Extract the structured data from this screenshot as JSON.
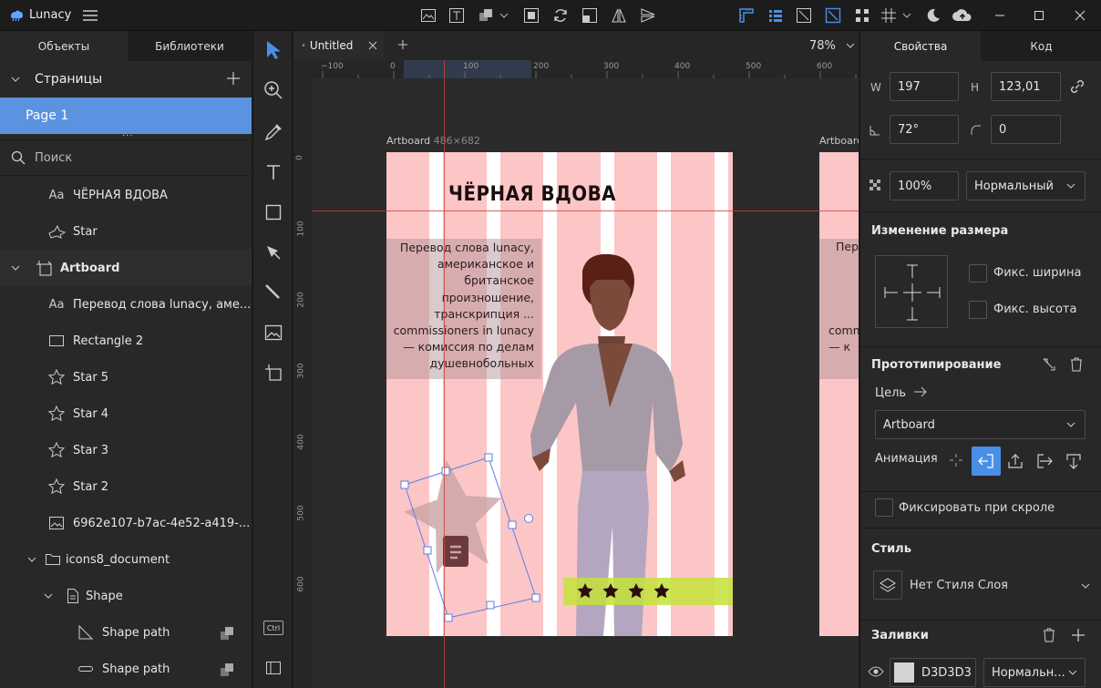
{
  "app": {
    "name": "Lunacy"
  },
  "left": {
    "tabs": [
      "Объекты",
      "Библиотеки"
    ],
    "pages_header": "Страницы",
    "page_selected": "Page 1",
    "search_placeholder": "Поиск",
    "layers": [
      {
        "label": "ЧЁРНАЯ  ВДОВА",
        "icon": "text-icon"
      },
      {
        "label": "Star",
        "icon": "star-outline-icon"
      },
      {
        "label": "Artboard",
        "icon": "artboard-icon"
      },
      {
        "label": "Перевод слова lunacy, аме...",
        "icon": "text-icon"
      },
      {
        "label": "Rectangle 2",
        "icon": "rectangle-icon"
      },
      {
        "label": "Star 5",
        "icon": "star-icon"
      },
      {
        "label": "Star 4",
        "icon": "star-icon"
      },
      {
        "label": "Star 3",
        "icon": "star-icon"
      },
      {
        "label": "Star 2",
        "icon": "star-icon"
      },
      {
        "label": "6962e107-b7ac-4e52-a419-...",
        "icon": "image-icon"
      },
      {
        "label": "icons8_document",
        "icon": "folder-icon"
      },
      {
        "label": "Shape",
        "icon": "shape-icon"
      },
      {
        "label": "Shape path",
        "icon": "triangle-path-icon"
      },
      {
        "label": "Shape path",
        "icon": "line-path-icon"
      }
    ]
  },
  "canvas": {
    "tab_title": "Untitled",
    "zoom": "78%",
    "hruler_labels": [
      "−100",
      "0",
      "100",
      "200",
      "300",
      "400",
      "500",
      "600"
    ],
    "vruler_labels": [
      "0",
      "100",
      "200",
      "300",
      "400",
      "500",
      "600"
    ],
    "artboard_label": "Artboard",
    "artboard_size": "486×682",
    "artboard2_label": "Artboard",
    "heading": "ЧЁРНАЯ  ВДОВА",
    "body_text": "Перевод слова lunacy, американское и британское произношение, транскрипция ... commissioners in lunacy — комиссия по делам душевнобольных",
    "body_text_partial": "Перев",
    "body_text_partial2": "commiss",
    "body_text_partial3": "— к",
    "stars_count": 4,
    "ctrl_label": "Ctrl"
  },
  "right": {
    "tabs": [
      "Свойства",
      "Код"
    ],
    "w_label": "W",
    "w_value": "197",
    "h_label": "H",
    "h_value": "123,01",
    "rotation": "72°",
    "radius": "0",
    "opacity": "100%",
    "blend": "Нормальный",
    "resize_header": "Изменение размера",
    "fix_width": "Фикс. ширина",
    "fix_height": "Фикс. высота",
    "proto_header": "Прототипирование",
    "target_label": "Цель",
    "target_value": "Artboard",
    "animation_label": "Анимация",
    "fix_scroll": "Фиксировать при скроле",
    "style_header": "Стиль",
    "style_value": "Нет Стиля Слоя",
    "fills_header": "Заливки",
    "fill_hex": "D3D3D3",
    "fill_blend": "Нормальн..."
  },
  "colors": {
    "accent": "#4a8fe7",
    "artboard_bg": "#fcc6c6",
    "fill_swatch": "#d3d3d3",
    "highlight_bar": "#c4e23a"
  }
}
